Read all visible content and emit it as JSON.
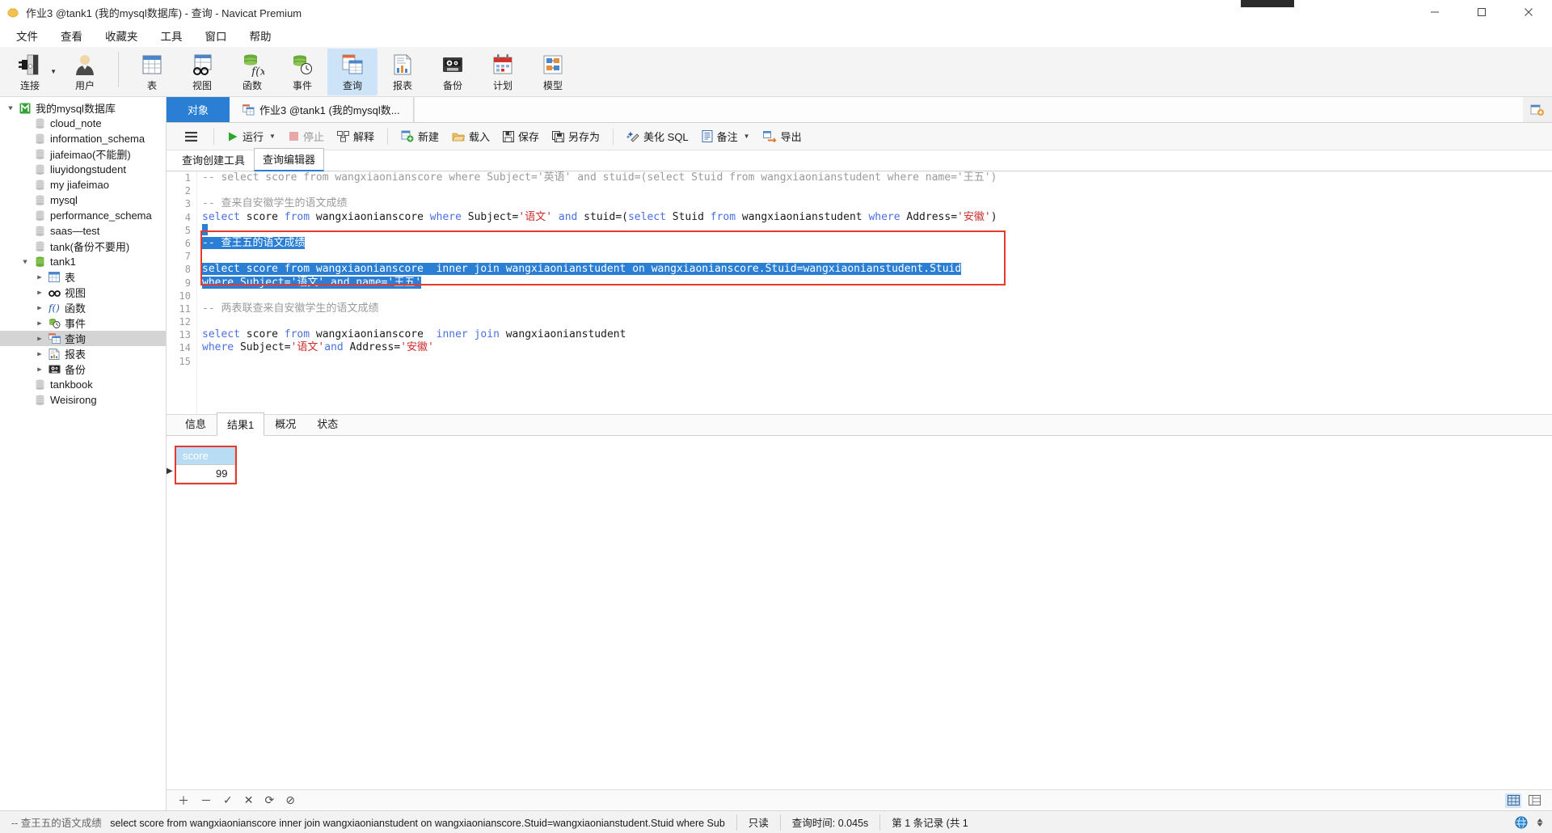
{
  "window": {
    "title": "作业3 @tank1 (我的mysql数据库) - 查询 - Navicat Premium",
    "app_icon": "navicat-icon",
    "minimize": "—",
    "maximize": "□",
    "close": "✕"
  },
  "menubar": {
    "items": [
      {
        "label": "文件",
        "name": "menu-file"
      },
      {
        "label": "查看",
        "name": "menu-view"
      },
      {
        "label": "收藏夹",
        "name": "menu-favorites"
      },
      {
        "label": "工具",
        "name": "menu-tools"
      },
      {
        "label": "窗口",
        "name": "menu-window"
      },
      {
        "label": "帮助",
        "name": "menu-help"
      }
    ]
  },
  "toolbar": {
    "items": [
      {
        "label": "连接",
        "icon": "connection-icon",
        "has_caret": true,
        "active": false
      },
      {
        "label": "用户",
        "icon": "user-icon",
        "has_caret": false,
        "active": false
      },
      {
        "label": "表",
        "icon": "table-icon",
        "has_caret": false,
        "active": false
      },
      {
        "label": "视图",
        "icon": "view-icon",
        "has_caret": false,
        "active": false
      },
      {
        "label": "函数",
        "icon": "function-icon",
        "has_caret": false,
        "active": false
      },
      {
        "label": "事件",
        "icon": "event-icon",
        "has_caret": false,
        "active": false
      },
      {
        "label": "查询",
        "icon": "query-icon",
        "has_caret": false,
        "active": true
      },
      {
        "label": "报表",
        "icon": "report-icon",
        "has_caret": false,
        "active": false
      },
      {
        "label": "备份",
        "icon": "backup-icon",
        "has_caret": false,
        "active": false
      },
      {
        "label": "计划",
        "icon": "schedule-icon",
        "has_caret": false,
        "active": false
      },
      {
        "label": "模型",
        "icon": "model-icon",
        "has_caret": false,
        "active": false
      }
    ]
  },
  "sidebar": {
    "items": [
      {
        "label": "我的mysql数据库",
        "indent": 0,
        "icon": "connection-green-icon",
        "twisty": "down",
        "selected": false
      },
      {
        "label": "cloud_note",
        "indent": 1,
        "icon": "database-gray-icon",
        "twisty": "",
        "selected": false
      },
      {
        "label": "information_schema",
        "indent": 1,
        "icon": "database-gray-icon",
        "twisty": "",
        "selected": false
      },
      {
        "label": "jiafeimao(不能删)",
        "indent": 1,
        "icon": "database-gray-icon",
        "twisty": "",
        "selected": false
      },
      {
        "label": "liuyidongstudent",
        "indent": 1,
        "icon": "database-gray-icon",
        "twisty": "",
        "selected": false
      },
      {
        "label": "my jiafeimao",
        "indent": 1,
        "icon": "database-gray-icon",
        "twisty": "",
        "selected": false
      },
      {
        "label": "mysql",
        "indent": 1,
        "icon": "database-gray-icon",
        "twisty": "",
        "selected": false
      },
      {
        "label": "performance_schema",
        "indent": 1,
        "icon": "database-gray-icon",
        "twisty": "",
        "selected": false
      },
      {
        "label": "saas—test",
        "indent": 1,
        "icon": "database-gray-icon",
        "twisty": "",
        "selected": false
      },
      {
        "label": "tank(备份不要用)",
        "indent": 1,
        "icon": "database-gray-icon",
        "twisty": "",
        "selected": false
      },
      {
        "label": "tank1",
        "indent": 1,
        "icon": "database-green-icon",
        "twisty": "down",
        "selected": false
      },
      {
        "label": "表",
        "indent": 2,
        "icon": "table-icon",
        "twisty": "right",
        "selected": false
      },
      {
        "label": "视图",
        "indent": 2,
        "icon": "view-icon",
        "twisty": "right",
        "selected": false
      },
      {
        "label": "函数",
        "indent": 2,
        "icon": "function-icon",
        "twisty": "right",
        "selected": false
      },
      {
        "label": "事件",
        "indent": 2,
        "icon": "event-icon",
        "twisty": "right",
        "selected": false
      },
      {
        "label": "查询",
        "indent": 2,
        "icon": "query-icon",
        "twisty": "right",
        "selected": true
      },
      {
        "label": "报表",
        "indent": 2,
        "icon": "report-icon",
        "twisty": "right",
        "selected": false
      },
      {
        "label": "备份",
        "indent": 2,
        "icon": "backup-icon",
        "twisty": "right",
        "selected": false
      },
      {
        "label": "tankbook",
        "indent": 1,
        "icon": "database-gray-icon",
        "twisty": "",
        "selected": false
      },
      {
        "label": "Weisirong",
        "indent": 1,
        "icon": "database-gray-icon",
        "twisty": "",
        "selected": false
      }
    ]
  },
  "objstrip": {
    "object_tab": "对象",
    "document_tab": "作业3 @tank1 (我的mysql数...",
    "document_tab_icon": "query-tab-icon",
    "add_icon": "add-tab-icon"
  },
  "query_toolbar": {
    "menu_icon": "hamburger-icon",
    "buttons": [
      {
        "label": "运行",
        "icon": "play-icon",
        "caret": true,
        "disabled": false
      },
      {
        "label": "停止",
        "icon": "stop-icon",
        "caret": false,
        "disabled": true
      },
      {
        "label": "解释",
        "icon": "explain-icon",
        "caret": false,
        "disabled": false
      },
      {
        "label": "新建",
        "icon": "new-icon",
        "caret": false,
        "disabled": false
      },
      {
        "label": "载入",
        "icon": "load-icon",
        "caret": false,
        "disabled": false
      },
      {
        "label": "保存",
        "icon": "save-icon",
        "caret": false,
        "disabled": false
      },
      {
        "label": "另存为",
        "icon": "save-as-icon",
        "caret": false,
        "disabled": false
      },
      {
        "label": "美化 SQL",
        "icon": "beautify-icon",
        "caret": false,
        "disabled": false
      },
      {
        "label": "备注",
        "icon": "comment-icon",
        "caret": true,
        "disabled": false
      },
      {
        "label": "导出",
        "icon": "export-icon",
        "caret": false,
        "disabled": false
      }
    ]
  },
  "editor_tabs": [
    {
      "label": "查询创建工具",
      "active": false
    },
    {
      "label": "查询编辑器",
      "active": true
    }
  ],
  "sql": {
    "line_numbers": [
      "1",
      "2",
      "3",
      "4",
      "5",
      "6",
      "7",
      "8",
      "9",
      "10",
      "11",
      "12",
      "13",
      "14",
      "15"
    ],
    "lines": [
      {
        "n": 1,
        "segments": [
          {
            "t": "-- select score from wangxiaonianscore where Subject='英语' and stuid=(select Stuid from wangxiaonianstudent where name='王五')",
            "c": "cmt"
          }
        ]
      },
      {
        "n": 2,
        "segments": []
      },
      {
        "n": 3,
        "segments": [
          {
            "t": "-- 查来自安徽学生的语文成绩",
            "c": "cmt"
          }
        ]
      },
      {
        "n": 4,
        "segments": [
          {
            "t": "select",
            "c": "kw"
          },
          {
            "t": " score ",
            "c": ""
          },
          {
            "t": "from",
            "c": "kw"
          },
          {
            "t": " wangxiaonianscore ",
            "c": ""
          },
          {
            "t": "where",
            "c": "kw"
          },
          {
            "t": " Subject=",
            "c": ""
          },
          {
            "t": "'语文'",
            "c": "str"
          },
          {
            "t": " ",
            "c": ""
          },
          {
            "t": "and",
            "c": "kw"
          },
          {
            "t": " stuid=(",
            "c": ""
          },
          {
            "t": "select",
            "c": "kw"
          },
          {
            "t": " Stuid ",
            "c": ""
          },
          {
            "t": "from",
            "c": "kw"
          },
          {
            "t": " wangxiaonianstudent ",
            "c": ""
          },
          {
            "t": "where",
            "c": "kw"
          },
          {
            "t": " Address=",
            "c": ""
          },
          {
            "t": "'安徽'",
            "c": "str"
          },
          {
            "t": ")",
            "c": ""
          }
        ]
      },
      {
        "n": 5,
        "segments": [],
        "caret": true
      },
      {
        "n": 6,
        "segments": [
          {
            "t": "-- 查王五的语文成绩",
            "c": "cmt"
          }
        ],
        "selected": true
      },
      {
        "n": 7,
        "segments": [],
        "selected": false
      },
      {
        "n": 8,
        "segments": [
          {
            "t": "select score from wangxiaonianscore  inner join wangxiaonianstudent on wangxiaonianscore.Stuid=wangxiaonianstudent.Stuid",
            "c": ""
          }
        ],
        "selected": true
      },
      {
        "n": 9,
        "segments": [
          {
            "t": "where Subject='语文' and name='王五'",
            "c": ""
          }
        ],
        "selected": true
      },
      {
        "n": 10,
        "segments": []
      },
      {
        "n": 11,
        "segments": [
          {
            "t": "-- 两表联查来自安徽学生的语文成绩",
            "c": "cmt"
          }
        ]
      },
      {
        "n": 12,
        "segments": []
      },
      {
        "n": 13,
        "segments": [
          {
            "t": "select",
            "c": "kw"
          },
          {
            "t": " score ",
            "c": ""
          },
          {
            "t": "from",
            "c": "kw"
          },
          {
            "t": " wangxiaonianscore  ",
            "c": ""
          },
          {
            "t": "inner join",
            "c": "kw"
          },
          {
            "t": " wangxiaonianstudent",
            "c": ""
          }
        ]
      },
      {
        "n": 14,
        "segments": [
          {
            "t": "where",
            "c": "kw"
          },
          {
            "t": " Subject=",
            "c": ""
          },
          {
            "t": "'语文'",
            "c": "str"
          },
          {
            "t": "and",
            "c": "kw"
          },
          {
            "t": " Address=",
            "c": ""
          },
          {
            "t": "'安徽'",
            "c": "str"
          }
        ]
      },
      {
        "n": 15,
        "segments": []
      }
    ]
  },
  "result_tabs": [
    {
      "label": "信息",
      "active": false
    },
    {
      "label": "结果1",
      "active": true
    },
    {
      "label": "概况",
      "active": false
    },
    {
      "label": "状态",
      "active": false
    }
  ],
  "result_grid": {
    "columns": [
      "score"
    ],
    "rows": [
      [
        "99"
      ]
    ],
    "current_row_marker": "▶"
  },
  "grid_nav": {
    "buttons": [
      {
        "icon": "plus-icon",
        "glyph": "＋",
        "name": "add-record-button"
      },
      {
        "icon": "minus-icon",
        "glyph": "－",
        "name": "delete-record-button"
      },
      {
        "icon": "check-icon",
        "glyph": "✓",
        "name": "apply-change-button"
      },
      {
        "icon": "cross-icon",
        "glyph": "✕",
        "name": "cancel-change-button"
      },
      {
        "icon": "refresh-icon",
        "glyph": "⟳",
        "name": "refresh-button"
      },
      {
        "icon": "stop-circle-icon",
        "glyph": "⊘",
        "name": "stop-button"
      }
    ],
    "view_grid_icon": "grid-view-icon",
    "view_form_icon": "form-view-icon"
  },
  "statusbar": {
    "sql_comment": "-- 查王五的语文成绩",
    "sql_text": "select score from wangxiaonianscore  inner join wangxiaonianstudent on wangxiaonianscore.Stuid=wangxiaonianstudent.Stuid where Sub",
    "readonly": "只读",
    "query_time_label": "查询时间: 0.045s",
    "record_info": "第 1 条记录 (共 1",
    "globe_icon": "globe-icon",
    "updown_icon": "updown-icon"
  },
  "colors": {
    "accent": "#2a7fd4",
    "selection": "#2a7fd4",
    "highlight_box": "#e8392f",
    "toolbar_bg": "#f4f4f4",
    "keyword": "#4a6fe0",
    "string": "#cc2b2b",
    "comment": "#9a9a9a"
  }
}
